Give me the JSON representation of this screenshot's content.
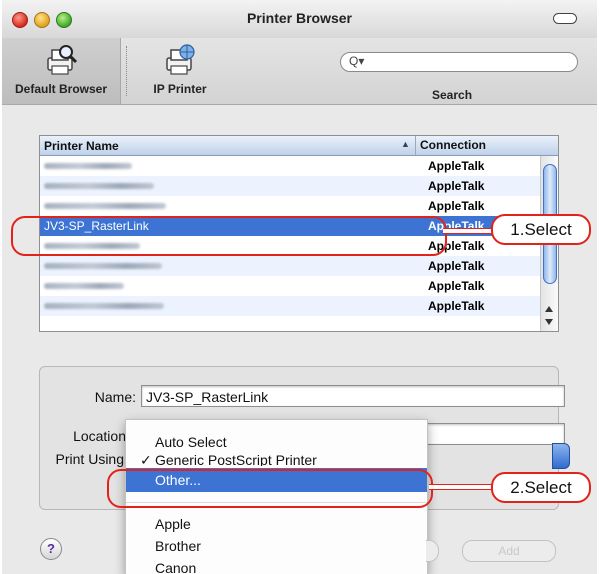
{
  "window": {
    "title": "Printer Browser"
  },
  "toolbar": {
    "default_browser_label": "Default Browser",
    "ip_printer_label": "IP Printer",
    "search_label": "Search",
    "search_glyph": "Q▾",
    "search_value": ""
  },
  "printer_list": {
    "col_name": "Printer Name",
    "col_connection": "Connection",
    "sort_indicator": "▲",
    "rows": [
      {
        "name": "",
        "connection": "AppleTalk",
        "blurred": true
      },
      {
        "name": "",
        "connection": "AppleTalk",
        "blurred": true
      },
      {
        "name": "",
        "connection": "AppleTalk",
        "blurred": true
      },
      {
        "name": "JV3-SP_RasterLink",
        "connection": "AppleTalk",
        "blurred": false,
        "selected": true
      },
      {
        "name": "",
        "connection": "AppleTalk",
        "blurred": true
      },
      {
        "name": "",
        "connection": "AppleTalk",
        "blurred": true
      },
      {
        "name": "",
        "connection": "AppleTalk",
        "blurred": true
      },
      {
        "name": "",
        "connection": "AppleTalk",
        "blurred": true
      }
    ]
  },
  "details": {
    "name_label": "Name:",
    "name_value": "JV3-SP_RasterLink",
    "location_label": "Location",
    "print_using_label": "Print Using"
  },
  "print_using_menu": {
    "items": [
      {
        "label": "Auto Select"
      },
      {
        "label": "Generic PostScript Printer",
        "checked": true,
        "check": "✓"
      },
      {
        "label": "Other...",
        "highlighted": true
      },
      {
        "label": "Apple"
      },
      {
        "label": "Brother"
      },
      {
        "label": "Canon"
      }
    ]
  },
  "buttons": {
    "help": "?",
    "more_printers": "More Printers...",
    "add": "Add"
  },
  "callouts": {
    "step1": "1.Select",
    "step2": "2.Select"
  },
  "colors": {
    "selection": "#3d74d4",
    "callout": "#e2231a"
  }
}
